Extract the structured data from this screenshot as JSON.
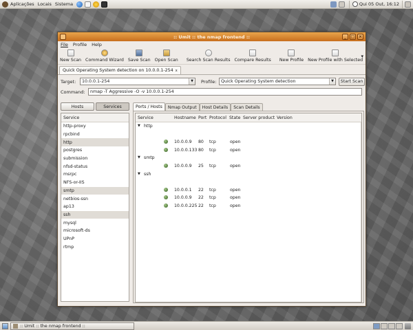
{
  "top_panel": {
    "menus": [
      "Aplicações",
      "Locais",
      "Sistema"
    ],
    "clock": "Qui 05 Out, 16:12"
  },
  "window": {
    "title": ":: Umit :: the nmap frontend ::",
    "menubar": [
      "File",
      "Profile",
      "Help"
    ],
    "toolbar": [
      "New Scan",
      "Command Wizard",
      "Save Scan",
      "Open Scan",
      "Search Scan Results",
      "Compare Results",
      "New Profile",
      "New Profile with Selected"
    ]
  },
  "scan_tab": "Quick Operating System detection on 10.0.0.1-254",
  "form": {
    "target_label": "Target:",
    "target_value": "10.0.0.1-254",
    "profile_label": "Profile:",
    "profile_value": "Quick Operating System detection",
    "scan_button": "Start Scan",
    "command_label": "Command:",
    "command_value": "nmap -T Aggressive -O -v 10.0.0.1-254"
  },
  "left_pane": {
    "tabs": [
      "Hosts",
      "Services"
    ],
    "active_tab": "Services",
    "header": "Service",
    "services": [
      "http-proxy",
      "rpcbind",
      "http",
      "postgres",
      "submission",
      "nfsd-status",
      "msrpc",
      "NFS-or-IIS",
      "smtp",
      "netbios-ssn",
      "ap13",
      "ssh",
      "mysql",
      "microsoft-ds",
      "UPnP",
      "rtmp"
    ],
    "highlighted": [
      "http",
      "smtp",
      "ssh"
    ]
  },
  "right_pane": {
    "tabs": [
      "Ports / Hosts",
      "Nmap Output",
      "Host Details",
      "Scan Details"
    ],
    "active_tab": "Ports / Hosts",
    "columns": [
      "Service",
      "Hostname",
      "Port",
      "Protocol",
      "State",
      "Server product",
      "Version"
    ],
    "groups": [
      {
        "service": "http",
        "rows": [
          {
            "hostname": "10.0.0.9",
            "port": "80",
            "protocol": "tcp",
            "state": "open"
          },
          {
            "hostname": "10.0.0.133",
            "port": "80",
            "protocol": "tcp",
            "state": "open"
          }
        ]
      },
      {
        "service": "smtp",
        "rows": [
          {
            "hostname": "10.0.0.9",
            "port": "25",
            "protocol": "tcp",
            "state": "open"
          }
        ]
      },
      {
        "service": "ssh",
        "rows": [
          {
            "hostname": "10.0.0.1",
            "port": "22",
            "protocol": "tcp",
            "state": "open"
          },
          {
            "hostname": "10.0.0.9",
            "port": "22",
            "protocol": "tcp",
            "state": "open"
          },
          {
            "hostname": "10.0.0.225",
            "port": "22",
            "protocol": "tcp",
            "state": "open"
          }
        ]
      }
    ]
  },
  "taskbar": {
    "task": ":: Umit :: the nmap frontend ::"
  },
  "colors": {
    "titlebar": "#d8852f",
    "highlight_row": "#e0dcd6"
  }
}
